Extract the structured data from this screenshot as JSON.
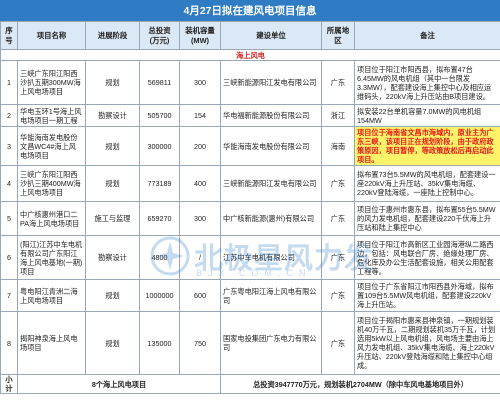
{
  "title": "4月27日拟在建风电项目信息",
  "headers": [
    "序号",
    "项目名称",
    "进展阶段",
    "总投资\n(万元)",
    "装机容量\n(MW)",
    "建设单位",
    "所属地区",
    "备注"
  ],
  "section": "海上风电",
  "rows": [
    {
      "no": "1",
      "name": "三峡广东阳江阳西沙扒五期300MW海上风电场项目",
      "stage": "规划",
      "invest": "569811",
      "cap": "300",
      "owner": "三峡新能源阳江发电有限公司",
      "region": "广东",
      "note": "项目位于阳江市阳西县，拟布置47台6.45MW的风电机组（其中一台限发3.3MW），配套建设海上集控中心及相应运维码头，220kV海上升压站由B项目建设。"
    },
    {
      "no": "2",
      "name": "华电玉环1号海上风电场项目一期工程",
      "stage": "勘察设计",
      "invest": "505700",
      "cap": "154",
      "owner": "华电福新能源股份有限公司",
      "region": "浙江",
      "note": "拟安装22台单机容量7.0MW的风电机组154MW"
    },
    {
      "no": "3",
      "name": "华能海南发电股份文昌WC4#海上风电场项目",
      "stage": "规划",
      "invest": "300000",
      "cap": "200",
      "owner": "华能海南发电股份有限公司",
      "region": "海南",
      "note": "项目位于海南省文昌市海域内，原业主为广东三峡，该项目正在规划阶段，由于政府政策原因，项目暂停，等政策放松后再启动此项目。"
    },
    {
      "no": "4",
      "name": "三峡广东阳江阳西沙扒三期400MW海上风电场项目",
      "stage": "规划",
      "invest": "773189",
      "cap": "400",
      "owner": "三峡新能源阳江发电有限公司",
      "region": "广东",
      "note": "拟布置73台5.5MW的风电机组，配套建设一座220kV海上升压站、35kV集电海缆、220kV登陆海缆，一座陆上控制中心。"
    },
    {
      "no": "5",
      "name": "中广核惠州港口二PA海上风电场项目",
      "stage": "施工与监理",
      "invest": "659270",
      "cap": "300",
      "owner": "中广核新能源(惠州)有限公司",
      "region": "广东",
      "note": "项目位于惠州市惠东县，拟布置55台5.5MW的风力发电机组，配套建设220千伏海上升压站和陆上集控中心"
    },
    {
      "no": "6",
      "name": "(阳江)江苏中车电机有限公司广东阳江海上风电基地(一期)项目",
      "stage": "勘察设计",
      "invest": "4800",
      "cap": "/",
      "owner": "江苏中车电机有限公司",
      "region": "广东",
      "note": "项目位于阳江市高新区工业园海港纵二路西边，包括：风电联合厂房、绝缘处理厂房、危化库及办公生活配套设施，相关公用配套工程等。"
    },
    {
      "no": "7",
      "name": "粤电阳江青洲二海上风电场项目",
      "stage": "规划",
      "invest": "1000000",
      "cap": "600",
      "owner": "广东粤电阳江海上风电有限公司",
      "region": "广东",
      "note": "项目位于广东省阳江市阳西县外海域，拟布置109台5.5MW风电机组，配套建设220kV海上升压站。"
    },
    {
      "no": "8",
      "name": "揭阳神泉海上风电场项目",
      "stage": "规划",
      "invest": "135000",
      "cap": "750",
      "owner": "国家电投集团广东电力有限公司",
      "region": "广东",
      "note": "项目位于揭阳市惠来县神泉镇，一期规划装机40万千瓦，二期规划装机35万千瓦，计划选用5kW以上风电机组，风电场主要由海上风力发电机组、35kV集电海缆、海上220kV升压站、220kV登陆海缆和陆上集控中心组成。"
    }
  ],
  "summary": {
    "label": "小计",
    "count": "8个海上风电项目",
    "totals": "总投资3947770万元，规划装机2704MW（除中车风电基地项目外）"
  },
  "watermark": {
    "text": "北极星风力发",
    "sub": "BJX.COM.CN"
  }
}
